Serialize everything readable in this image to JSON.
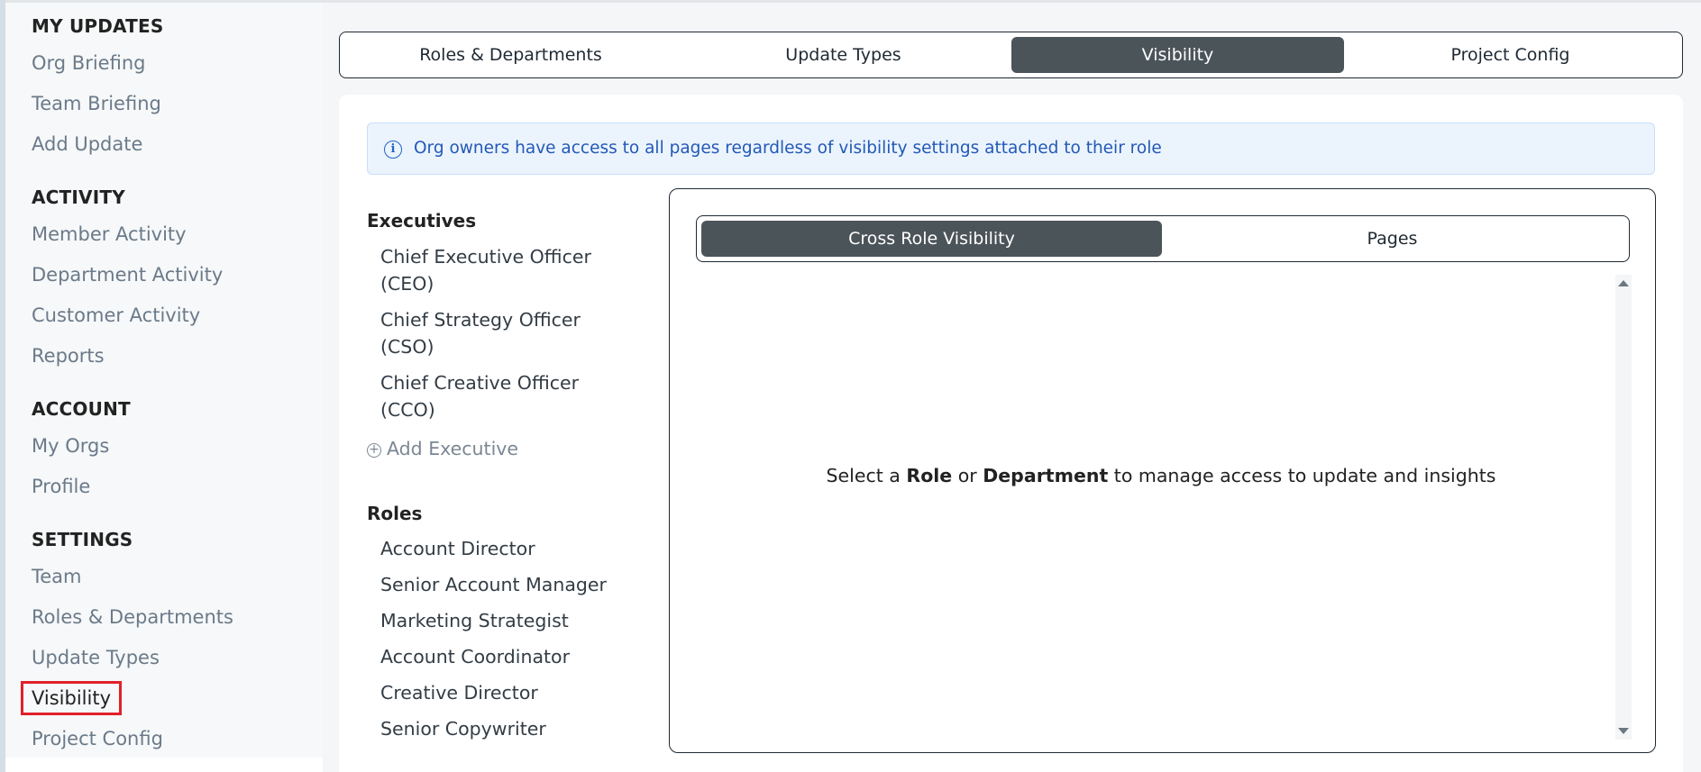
{
  "sidebar": {
    "my_updates": {
      "heading": "MY UPDATES",
      "items": [
        "Org Briefing",
        "Team Briefing",
        "Add Update"
      ]
    },
    "activity": {
      "heading": "ACTIVITY",
      "items": [
        "Member Activity",
        "Department Activity",
        "Customer Activity",
        "Reports"
      ]
    },
    "account": {
      "heading": "ACCOUNT",
      "items": [
        "My Orgs",
        "Profile"
      ]
    },
    "settings": {
      "heading": "SETTINGS",
      "items": [
        "Team",
        "Roles & Departments",
        "Update Types",
        "Visibility",
        "Project Config"
      ],
      "active": "Visibility"
    }
  },
  "top_tabs": {
    "items": [
      "Roles & Departments",
      "Update Types",
      "Visibility",
      "Project Config"
    ],
    "active": "Visibility"
  },
  "notice": {
    "icon": "info-icon",
    "text": "Org owners have access to all pages regardless of visibility settings attached to their role"
  },
  "executives": {
    "heading": "Executives",
    "items": [
      "Chief Executive Officer (CEO)",
      "Chief Strategy Officer (CSO)",
      "Chief Creative Officer (CCO)"
    ],
    "add_label": "Add Executive"
  },
  "roles": {
    "heading": "Roles",
    "items": [
      "Account Director",
      "Senior Account Manager",
      "Marketing Strategist",
      "Account Coordinator",
      "Creative Director",
      "Senior Copywriter"
    ]
  },
  "visibility_panel": {
    "tabs": [
      "Cross Role Visibility",
      "Pages"
    ],
    "active": "Cross Role Visibility",
    "empty": {
      "pre": "Select a",
      "role": "Role",
      "or": "or",
      "department": "Department",
      "post": "to manage access to update and insights"
    }
  },
  "colors": {
    "active_tab": "#4b5459",
    "notice_bg": "#ebf4fd",
    "notice_text": "#2358b7",
    "active_highlight": "#e0202a"
  }
}
